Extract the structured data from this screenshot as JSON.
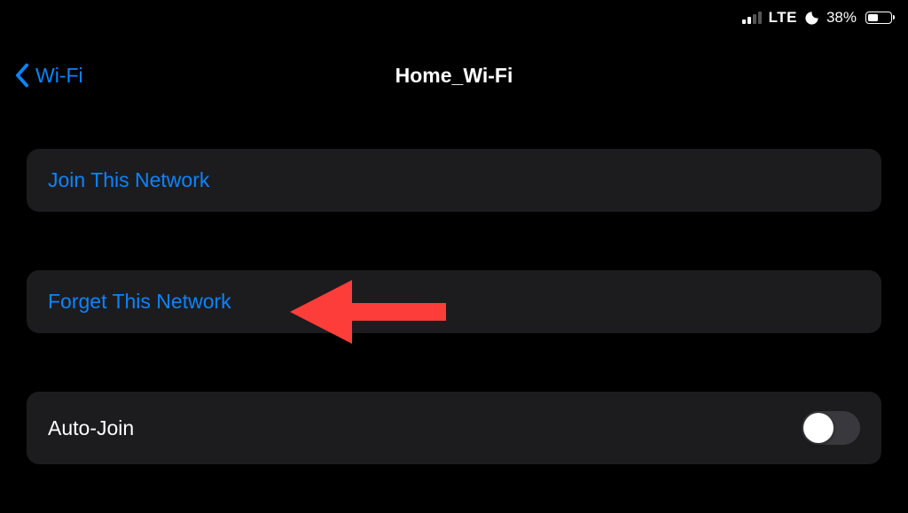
{
  "status_bar": {
    "network_type": "LTE",
    "battery_percent": "38%",
    "battery_level": 38
  },
  "nav": {
    "back_label": "Wi-Fi",
    "title": "Home_Wi-Fi"
  },
  "cells": {
    "join_label": "Join This Network",
    "forget_label": "Forget This Network",
    "autojoin_label": "Auto-Join"
  },
  "toggle": {
    "autojoin_on": false
  },
  "colors": {
    "blue": "#0a84ff",
    "cell_bg": "#1c1c1e",
    "annotation": "#ff3b30"
  }
}
